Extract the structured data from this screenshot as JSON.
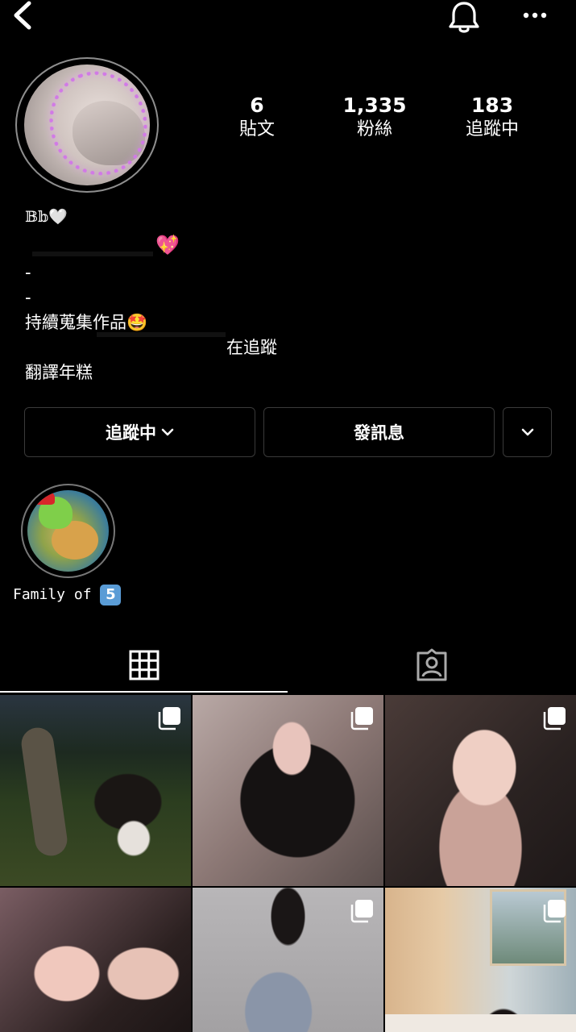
{
  "stats": {
    "posts": {
      "value": "6",
      "label": "貼文"
    },
    "followers": {
      "value": "1,335",
      "label": "粉絲"
    },
    "following": {
      "value": "183",
      "label": "追蹤中"
    }
  },
  "bio": {
    "name": "𝔹𝕓🤍",
    "heart_emoji": "💖",
    "line_dash_1": "-",
    "line_dash_2": "-",
    "collect_line": "持續蒐集作品🤩",
    "following_line": "在追蹤",
    "translate_line": "翻譯年糕"
  },
  "buttons": {
    "following_label": "追蹤中",
    "message_label": "發訊息"
  },
  "highlight": {
    "label": "Family of",
    "badge": "5"
  },
  "icons": {
    "back": "chevron-left-icon",
    "bell": "bell-icon",
    "more": "more-horizontal-icon",
    "grid": "grid-icon",
    "tagged": "tagged-person-icon",
    "multi": "multi-post-icon"
  },
  "colors": {
    "background": "#000000",
    "text": "#ffffff",
    "border": "#3a3a3a"
  }
}
